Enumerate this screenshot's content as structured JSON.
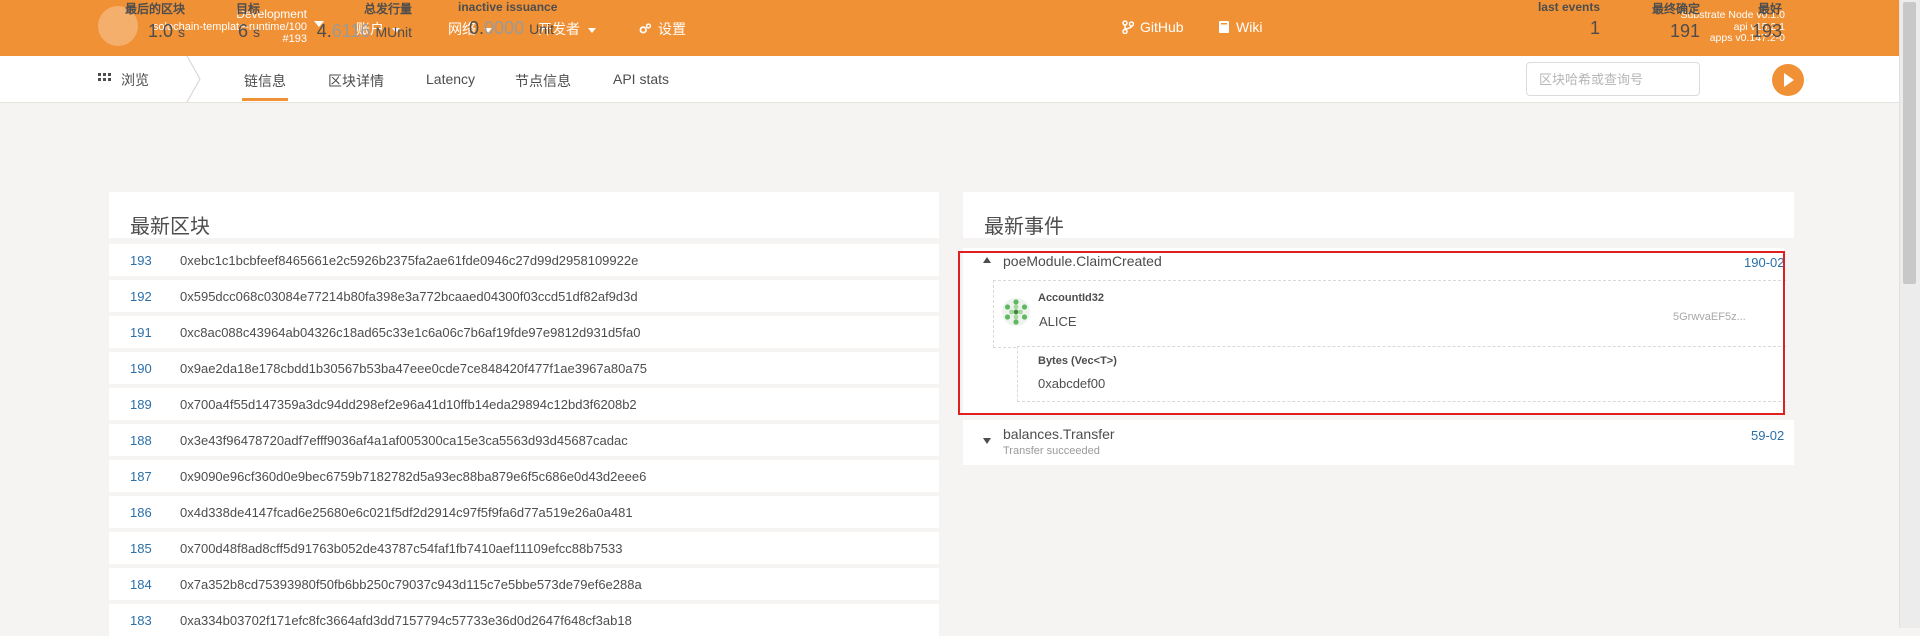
{
  "header": {
    "chain_env": "Development",
    "chain_name": "solochain-template-runtime/100",
    "chain_block": "#193",
    "nav": {
      "accounts": "账户",
      "network": "网络",
      "developer": "开发者",
      "settings": "设置"
    },
    "links": {
      "github": "GitHub",
      "wiki": "Wiki"
    },
    "version": {
      "node": "Substrate Node v0.1.0",
      "api": "api v15.2.1",
      "apps": "apps v0.147.2-0"
    },
    "accent": "#f19135"
  },
  "subnav": {
    "browse": "浏览",
    "tabs": [
      "链信息",
      "区块详情",
      "Latency",
      "节点信息",
      "API stats"
    ],
    "active_tab": "链信息",
    "search_placeholder": "区块哈希或查询号"
  },
  "stats": {
    "last_block": {
      "label": "最后的区块",
      "value": "1.0",
      "unit": "s"
    },
    "target": {
      "label": "目标",
      "value": "6",
      "unit": "s"
    },
    "total_issuance": {
      "label": "总发行量",
      "value_main": "4.",
      "value_dim": "6116",
      "unit": "MUnit"
    },
    "inactive_issuance": {
      "label": "inactive issuance",
      "value_main": "0.",
      "value_dim": "0000",
      "unit": "Unit"
    },
    "last_events": {
      "label": "last events",
      "value": "1"
    },
    "finalized": {
      "label": "最终确定",
      "value": "191"
    },
    "best": {
      "label": "最好",
      "value": "193"
    }
  },
  "recent_blocks": {
    "title": "最新区块",
    "rows": [
      {
        "number": "193",
        "hash": "0xebc1c1bcbfeef8465661e2c5926b2375fa2ae61fde0946c27d99d2958109922e"
      },
      {
        "number": "192",
        "hash": "0x595dcc068c03084e77214b80fa398e3a772bcaaed04300f03ccd51df82af9d3d"
      },
      {
        "number": "191",
        "hash": "0xc8ac088c43964ab04326c18ad65c33e1c6a06c7b6af19fde97e9812d931d5fa0"
      },
      {
        "number": "190",
        "hash": "0x9ae2da18e178cbdd1b30567b53ba47eee0cde7ce848420f477f1ae3967a80a75"
      },
      {
        "number": "189",
        "hash": "0x700a4f55d147359a3dc94dd298ef2e96a41d10ffb14eda29894c12bd3f6208b2"
      },
      {
        "number": "188",
        "hash": "0x3e43f96478720adf7efff9036af4a1af005300ca15e3ca5563d93d45687cadac"
      },
      {
        "number": "187",
        "hash": "0x9090e96cf360d0e9bec6759b7182782d5a93ec88ba879e6f5c686e0d43d2eee6"
      },
      {
        "number": "186",
        "hash": "0x4d338de4147fcad6e25680e6c021f5df2d2914c97f5f9fa6d77a519e26a0a481"
      },
      {
        "number": "185",
        "hash": "0x700d48f8ad8cff5d91763b052de43787c54faf1fb7410aef11109efcc88b7533"
      },
      {
        "number": "184",
        "hash": "0x7a352b8cd75393980f50fb6bb250c79037c943d115c7e5bbe573de79ef6e288a"
      },
      {
        "number": "183",
        "hash": "0xa334b03702f171efc8fc3664afd3dd7157794c57733e36d0d2647f648cf3ab18"
      }
    ]
  },
  "recent_events": {
    "title": "最新事件",
    "events": [
      {
        "name": "poeModule.ClaimCreated",
        "ref": "190-02",
        "params": [
          {
            "type": "AccountId32",
            "value": "ALICE",
            "address": "5GrwvaEF5z..."
          },
          {
            "type": "Bytes (Vec<T>)",
            "value": "0xabcdef00"
          }
        ]
      },
      {
        "name": "balances.Transfer",
        "desc": "Transfer succeeded",
        "ref": "59-02"
      }
    ]
  }
}
